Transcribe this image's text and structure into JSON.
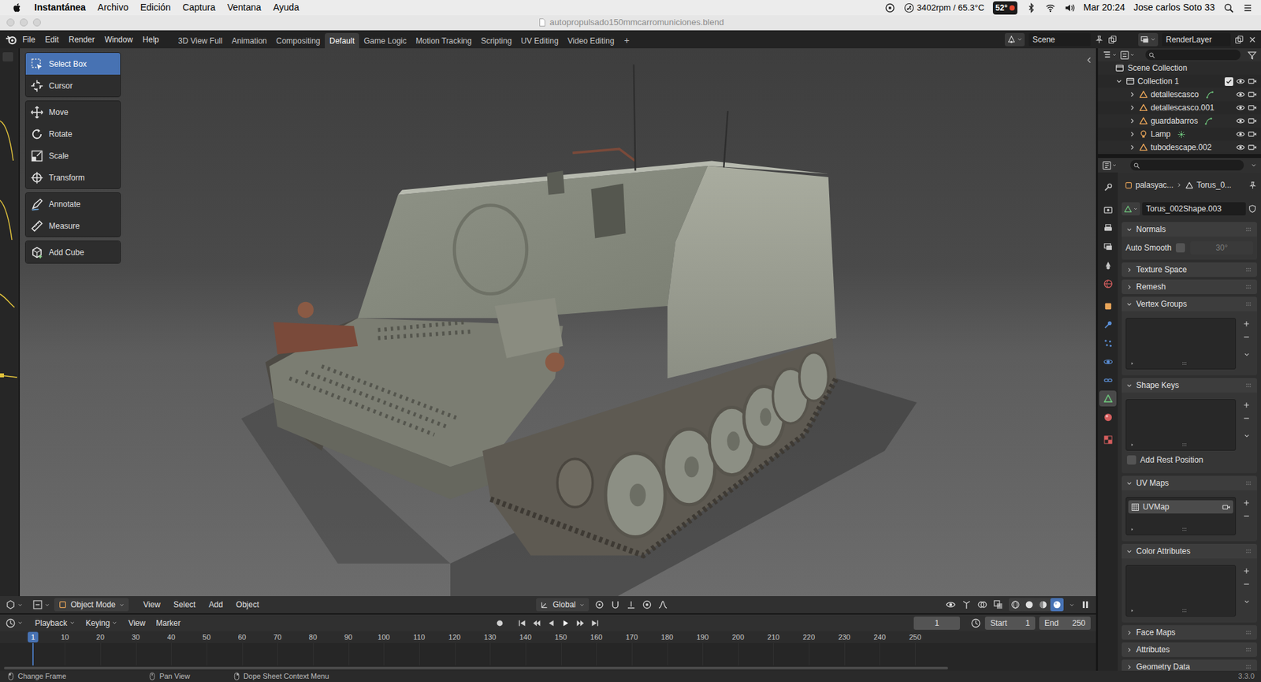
{
  "mac_menubar": {
    "app": "Instantánea",
    "menus": [
      "Archivo",
      "Edición",
      "Captura",
      "Ventana",
      "Ayuda"
    ],
    "fan": "3402rpm / 65.3°C",
    "temp": "52°",
    "clock": "Mar 20:24",
    "user": "Jose carlos Soto 33"
  },
  "window": {
    "title": "autopropulsado150mmcarromuniciones.blend"
  },
  "topbar": {
    "menus": [
      "File",
      "Edit",
      "Render",
      "Window",
      "Help"
    ],
    "workspaces": [
      {
        "label": "3D View Full",
        "selected": false
      },
      {
        "label": "Animation",
        "selected": false
      },
      {
        "label": "Compositing",
        "selected": false
      },
      {
        "label": "Default",
        "selected": true
      },
      {
        "label": "Game Logic",
        "selected": false
      },
      {
        "label": "Motion Tracking",
        "selected": false
      },
      {
        "label": "Scripting",
        "selected": false
      },
      {
        "label": "UV Editing",
        "selected": false
      },
      {
        "label": "Video Editing",
        "selected": false
      }
    ],
    "add_workspace": "+",
    "scene": "Scene",
    "view_layer": "RenderLayer"
  },
  "toolbar": [
    {
      "label": "Select Box",
      "selected": true
    },
    {
      "label": "Cursor",
      "selected": false
    },
    {
      "label": "Move",
      "selected": false
    },
    {
      "label": "Rotate",
      "selected": false
    },
    {
      "label": "Scale",
      "selected": false
    },
    {
      "label": "Transform",
      "selected": false
    },
    {
      "label": "Annotate",
      "selected": false
    },
    {
      "label": "Measure",
      "selected": false
    },
    {
      "label": "Add Cube",
      "selected": false
    }
  ],
  "viewport_header": {
    "mode": "Object Mode",
    "menus": [
      "View",
      "Select",
      "Add",
      "Object"
    ],
    "orientation": "Global",
    "shading": [
      {
        "selected": false
      },
      {
        "selected": false
      },
      {
        "selected": false
      },
      {
        "selected": true
      }
    ]
  },
  "timeline": {
    "menus": [
      {
        "label": "Playback",
        "dropdown": true
      },
      {
        "label": "Keying",
        "dropdown": true
      },
      {
        "label": "View",
        "dropdown": false
      },
      {
        "label": "Marker",
        "dropdown": false
      }
    ],
    "frame": "1",
    "start_label": "Start",
    "start": "1",
    "end_label": "End",
    "end": "250",
    "playhead": "1",
    "ticks": [
      "10",
      "20",
      "30",
      "40",
      "50",
      "60",
      "70",
      "80",
      "90",
      "100",
      "110",
      "120",
      "130",
      "140",
      "150",
      "160",
      "170",
      "180",
      "190",
      "200",
      "210",
      "220",
      "230",
      "240",
      "250"
    ]
  },
  "outliner": {
    "root": "Scene Collection",
    "collection": {
      "name": "Collection 1",
      "expanded": true,
      "checked": true,
      "visible": true,
      "renderable": true
    },
    "objects": [
      {
        "name": "detallescasco",
        "kind": "mesh",
        "badge": true,
        "expanded": false,
        "visible": true,
        "renderable": true
      },
      {
        "name": "detallescasco.001",
        "kind": "mesh",
        "badge": false,
        "expanded": false,
        "visible": true,
        "renderable": true
      },
      {
        "name": "guardabarros",
        "kind": "mesh",
        "badge": true,
        "expanded": false,
        "visible": true,
        "renderable": true
      },
      {
        "name": "Lamp",
        "kind": "light",
        "badge": true,
        "expanded": false,
        "visible": true,
        "renderable": true
      },
      {
        "name": "tubodescape.002",
        "kind": "mesh",
        "badge": false,
        "expanded": false,
        "visible": true,
        "renderable": true
      }
    ]
  },
  "properties": {
    "tabs": [
      {
        "color": "#c8c8c8",
        "selected": false
      },
      {
        "color": "#c8c8c8",
        "selected": false
      },
      {
        "color": "#c8c8c8",
        "selected": false
      },
      {
        "color": "#c8c8c8",
        "selected": false
      },
      {
        "color": "#c8c8c8",
        "selected": false
      },
      {
        "color": "#d35d5d",
        "selected": false
      },
      {
        "color": "#e8a458",
        "selected": false
      },
      {
        "color": "#5b8fd6",
        "selected": false
      },
      {
        "color": "#5b8fd6",
        "selected": false
      },
      {
        "color": "#5b8fd6",
        "selected": false
      },
      {
        "color": "#5b8fd6",
        "selected": false
      },
      {
        "color": "#6cc07a",
        "selected": true
      },
      {
        "color": "#d35d5d",
        "selected": false
      },
      {
        "color": "#d35d5d",
        "selected": false
      }
    ],
    "breadcrumb": {
      "object": "palasyac...",
      "data": "Torus_0..."
    },
    "mesh": "Torus_002Shape.003",
    "panels": [
      {
        "kind": "normals",
        "title": "Normals",
        "expanded": true,
        "label": "Auto Smooth",
        "checked": false,
        "angle": "30°",
        "angle_disabled": true
      },
      {
        "kind": "header",
        "title": "Texture Space",
        "expanded": false
      },
      {
        "kind": "header",
        "title": "Remesh",
        "expanded": false
      },
      {
        "kind": "list",
        "title": "Vertex Groups",
        "expanded": true,
        "items": [],
        "has_menu": true
      },
      {
        "kind": "list",
        "title": "Shape Keys",
        "expanded": true,
        "items": [],
        "has_menu": true,
        "option": {
          "label": "Add Rest Position",
          "checked": false
        }
      },
      {
        "kind": "list",
        "title": "UV Maps",
        "expanded": true,
        "items": [
          {
            "name": "UVMap",
            "selected": true,
            "active_render": true
          }
        ],
        "has_menu": false
      },
      {
        "kind": "list",
        "title": "Color Attributes",
        "expanded": true,
        "items": [],
        "has_menu": true
      },
      {
        "kind": "header",
        "title": "Face Maps",
        "expanded": false
      },
      {
        "kind": "header",
        "title": "Attributes",
        "expanded": false
      },
      {
        "kind": "header",
        "title": "Geometry Data",
        "expanded": false
      }
    ]
  },
  "status_bar": {
    "hints": [
      "Change Frame",
      "Pan View",
      "Dope Sheet Context Menu"
    ],
    "version": "3.3.0"
  }
}
